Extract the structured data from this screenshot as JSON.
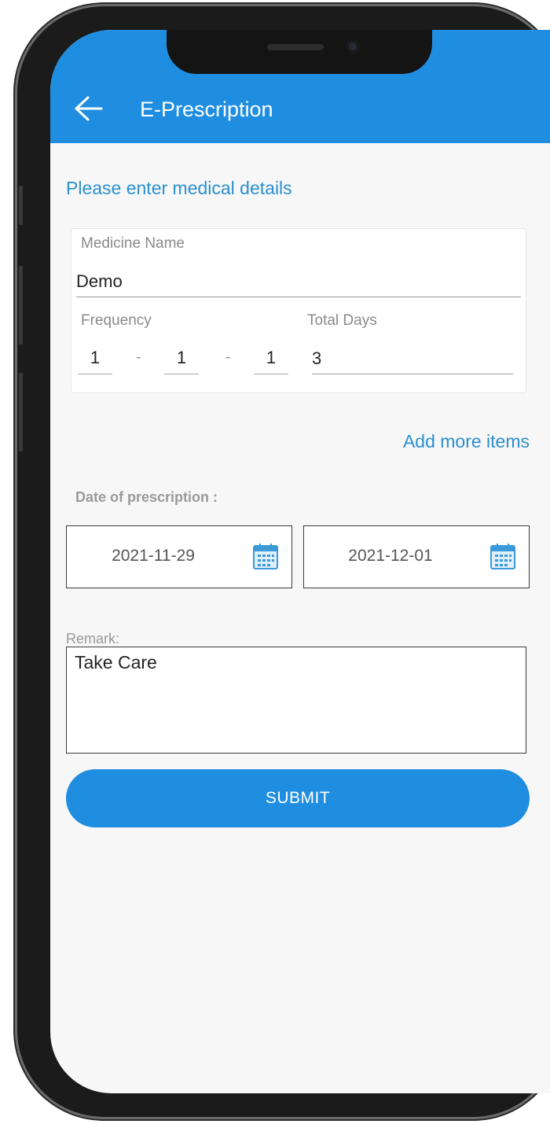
{
  "header": {
    "title": "E-Prescription",
    "back_icon": "arrow-left-icon"
  },
  "colors": {
    "primary": "#1f8ee0",
    "link": "#2b8fd0"
  },
  "form": {
    "hint": "Please enter medical details",
    "medicine": {
      "label": "Medicine Name",
      "value": "Demo"
    },
    "frequency": {
      "label": "Frequency",
      "values": [
        "1",
        "1",
        "1"
      ],
      "separator": "-"
    },
    "total_days": {
      "label": "Total Days",
      "value": "3"
    },
    "add_more_label": "Add more items",
    "date_label": "Date of prescription :",
    "dates": [
      {
        "value": "2021-11-29",
        "icon": "calendar-icon"
      },
      {
        "value": "2021-12-01",
        "icon": "calendar-icon"
      }
    ],
    "remark": {
      "label": "Remark:",
      "value": "Take Care"
    },
    "submit_label": "SUBMIT"
  }
}
